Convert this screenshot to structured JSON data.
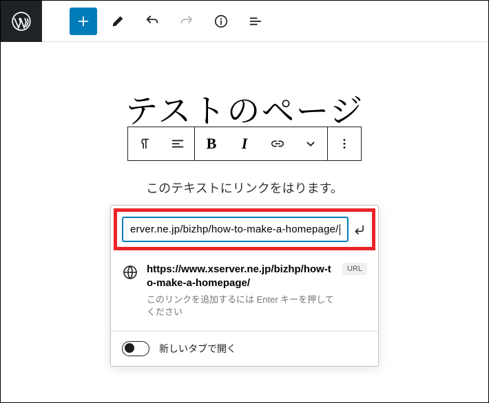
{
  "page_title": "テストのページ",
  "paragraph_text": "このテキストにリンクをはります。",
  "link_popover": {
    "input_value": "erver.ne.jp/bizhp/how-to-make-a-homepage/",
    "suggestion_url": "https://www.xserver.ne.jp/bizhp/how-to-make-a-homepage/",
    "suggestion_help": "このリンクを追加するには Enter キーを押してください",
    "url_badge": "URL",
    "new_tab_label": "新しいタブで開く"
  },
  "block_toolbar": {
    "bold": "B",
    "italic": "I"
  }
}
